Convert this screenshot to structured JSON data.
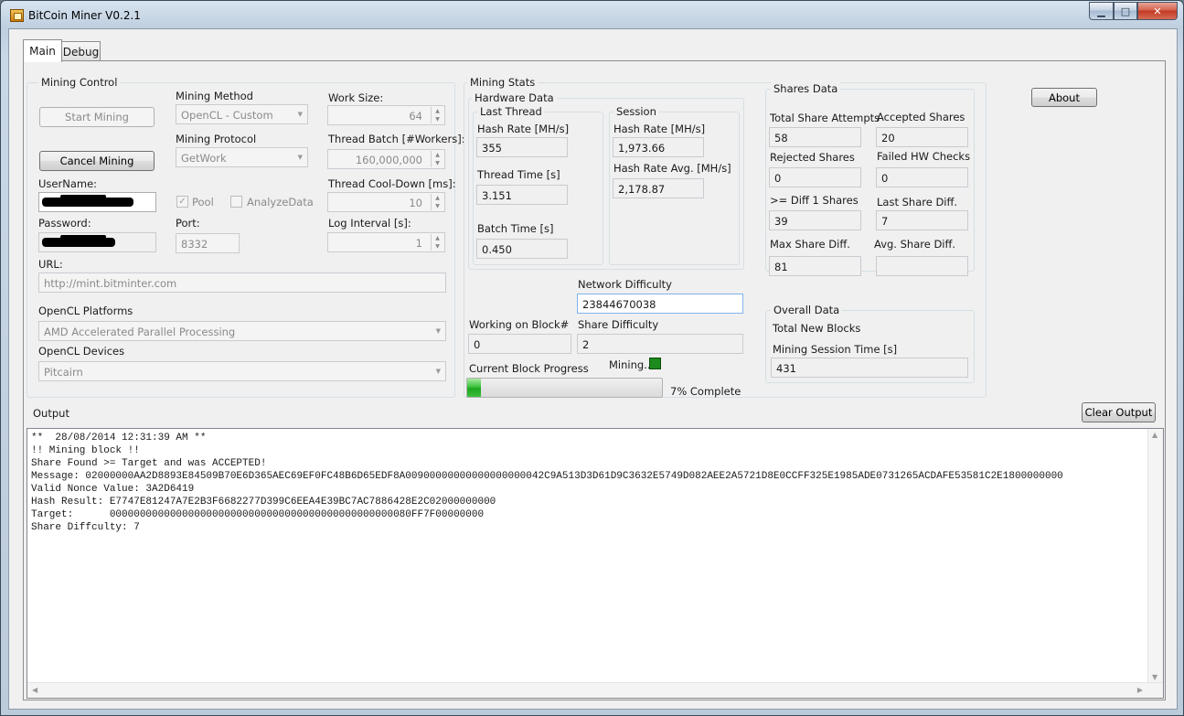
{
  "window": {
    "title": "BitCoin Miner V0.2.1"
  },
  "tabs": [
    "Main",
    "Debug"
  ],
  "mining_control": {
    "title": "Mining Control",
    "start_label": "Start Mining",
    "cancel_label": "Cancel Mining",
    "username_label": "UserName:",
    "password_label": "Password:",
    "url_label": "URL:",
    "url_value": "http://mint.bitminter.com",
    "method_label": "Mining Method",
    "method_value": "OpenCL - Custom",
    "protocol_label": "Mining Protocol",
    "protocol_value": "GetWork",
    "pool_label": "Pool",
    "pool_checked": true,
    "analyze_label": "AnalyzeData",
    "analyze_checked": false,
    "port_label": "Port:",
    "port_value": "8332",
    "work_size_label": "Work Size:",
    "work_size_value": "64",
    "thread_batch_label": "Thread Batch [#Workers]:",
    "thread_batch_value": "160,000,000",
    "cooldown_label": "Thread Cool-Down [ms]:",
    "cooldown_value": "10",
    "log_interval_label": "Log Interval [s]:",
    "log_interval_value": "1",
    "platforms_label": "OpenCL Platforms",
    "platforms_value": "AMD Accelerated Parallel Processing",
    "devices_label": "OpenCL Devices",
    "devices_value": "Pitcairn"
  },
  "mining_stats": {
    "title": "Mining Stats",
    "hardware_title": "Hardware Data",
    "last_thread_title": "Last Thread",
    "session_title": "Session",
    "hash_rate_label": "Hash Rate [MH/s]",
    "last_hash_rate": "355",
    "thread_time_label": "Thread Time [s]",
    "thread_time": "3.151",
    "batch_time_label": "Batch Time [s]",
    "batch_time": "0.450",
    "session_hash_rate_label": "Hash Rate [MH/s]",
    "session_hash_rate": "1,973.66",
    "hash_rate_avg_label": "Hash Rate Avg. [MH/s]",
    "hash_rate_avg": "2,178.87",
    "network_difficulty_label": "Network Difficulty",
    "network_difficulty": "23844670038",
    "working_block_label": "Working on Block#",
    "working_block": "0",
    "share_difficulty_label": "Share Difficulty",
    "share_difficulty": "2",
    "progress_label": "Current Block Progress",
    "mining_status": "Mining...",
    "progress_percent": 7,
    "progress_text": "7% Complete"
  },
  "shares": {
    "title": "Shares Data",
    "total_attempts_label": "Total Share Attempts",
    "total_attempts": "58",
    "accepted_label": "Accepted Shares",
    "accepted": "20",
    "rejected_label": "Rejected Shares",
    "rejected": "0",
    "failed_hw_label": "Failed HW Checks",
    "failed_hw": "0",
    "diff1_label": ">= Diff 1 Shares",
    "diff1": "39",
    "last_diff_label": "Last Share Diff.",
    "last_diff": "7",
    "max_diff_label": "Max Share Diff.",
    "max_diff": "81",
    "avg_diff_label": "Avg. Share Diff.",
    "avg_diff": ""
  },
  "overall": {
    "title": "Overall Data",
    "total_blocks_label": "Total New Blocks",
    "session_time_label": "Mining Session Time [s]",
    "session_time": "431"
  },
  "about_label": "About",
  "output": {
    "label": "Output",
    "clear_label": "Clear Output",
    "lines": [
      "**  28/08/2014 12:31:39 AM **",
      "!! Mining block !!",
      "Share Found >= Target and was ACCEPTED!",
      "Message: 02000000AA2D8893E84509B70E6D365AEC69EF0FC48B6D65EDF8A00900000000000000000042C9A513D3D61D9C3632E5749D082AEE2A5721D8E0CCFF325E1985ADE0731265ACDAFE53581C2E1800000000",
      "Valid Nonce Value: 3A2D6419",
      "Hash Result: E7747E81247A7E2B3F6682277D399C6EEA4E39BC7AC7886428E2C02000000000",
      "Target:      00000000000000000000000000000000000000000000000080FF7F00000000",
      "Share Diffculty: 7"
    ]
  }
}
